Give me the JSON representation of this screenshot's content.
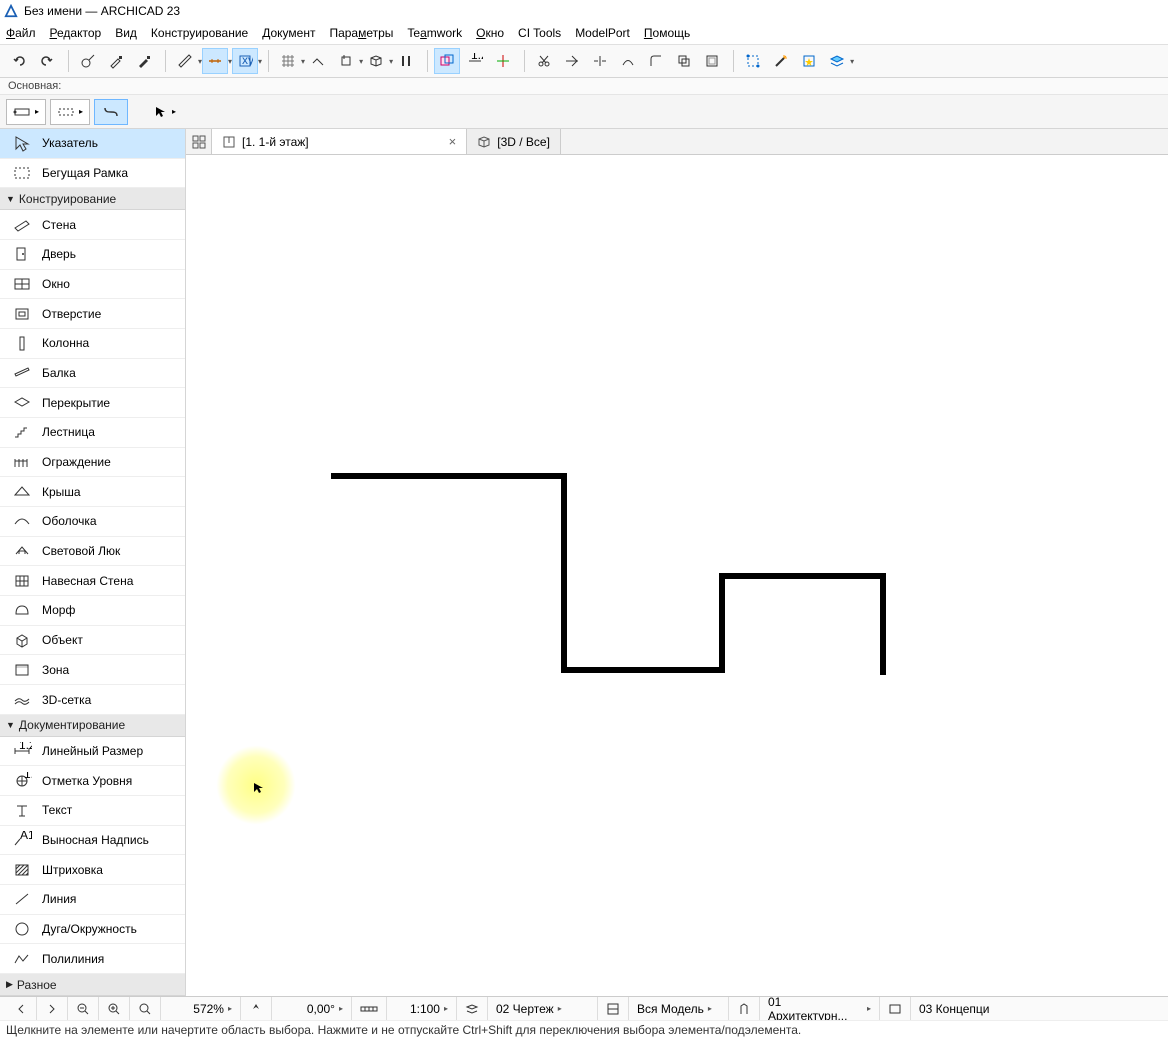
{
  "title": "Без имени — ARCHICAD 23",
  "menu": [
    "Файл",
    "Редактор",
    "Вид",
    "Конструирование",
    "Документ",
    "Параметры",
    "Teamwork",
    "Окно",
    "CI Tools",
    "ModelPort",
    "Помощь"
  ],
  "menu_underline_idx": [
    0,
    0,
    -1,
    -1,
    -1,
    4,
    2,
    0,
    -1,
    -1,
    0
  ],
  "layer_label": "Основная:",
  "tabs": {
    "floor": "[1. 1-й этаж]",
    "view3d": "[3D / Все]"
  },
  "toolbox": {
    "arrow": "Указатель",
    "marquee": "Бегущая Рамка",
    "section_design": "Конструирование",
    "items_design": [
      "Стена",
      "Дверь",
      "Окно",
      "Отверстие",
      "Колонна",
      "Балка",
      "Перекрытие",
      "Лестница",
      "Ограждение",
      "Крыша",
      "Оболочка",
      "Световой Люк",
      "Навесная Стена",
      "Морф",
      "Объект",
      "Зона",
      "3D-сетка"
    ],
    "section_doc": "Документирование",
    "items_doc": [
      "Линейный Размер",
      "Отметка Уровня",
      "Текст",
      "Выносная Надпись",
      "Штриховка",
      "Линия",
      "Дуга/Окружность",
      "Полилиния"
    ],
    "section_other": "Разное"
  },
  "status": {
    "zoom": "572%",
    "angle": "0,00°",
    "scale": "1:100",
    "drawing": "02 Чертеж",
    "model": "Вся Модель",
    "arch": "01 Архитектурн...",
    "concept": "03 Концепци"
  },
  "hint": "Щелкните на элементе или начертите область выбора. Нажмите и не отпускайте Ctrl+Shift для переключения выбора элемента/подэлемента."
}
